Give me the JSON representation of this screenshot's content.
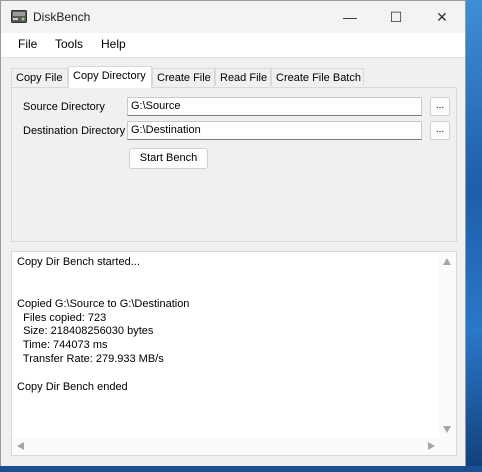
{
  "window": {
    "title": "DiskBench",
    "controls": {
      "minimize": "—",
      "maximize": "☐",
      "close": "✕"
    }
  },
  "menu": [
    "File",
    "Tools",
    "Help"
  ],
  "tabs": [
    {
      "label": "Copy File",
      "active": false
    },
    {
      "label": "Copy Directory",
      "active": true
    },
    {
      "label": "Create File",
      "active": false
    },
    {
      "label": "Read File",
      "active": false
    },
    {
      "label": "Create File Batch",
      "active": false
    }
  ],
  "form": {
    "source_label": "Source Directory",
    "source_value": "G:\\Source",
    "destination_label": "Destination Directory",
    "destination_value": "G:\\Destination",
    "browse_label": "...",
    "start_button": "Start Bench"
  },
  "output": {
    "lines": [
      "Copy Dir Bench started...",
      "",
      "",
      "Copied G:\\Source to G:\\Destination",
      "  Files copied: 723",
      "  Size: 218408256030 bytes",
      "  Time: 744073 ms",
      "  Transfer Rate: 279.933 MB/s",
      "",
      "Copy Dir Bench ended"
    ]
  }
}
